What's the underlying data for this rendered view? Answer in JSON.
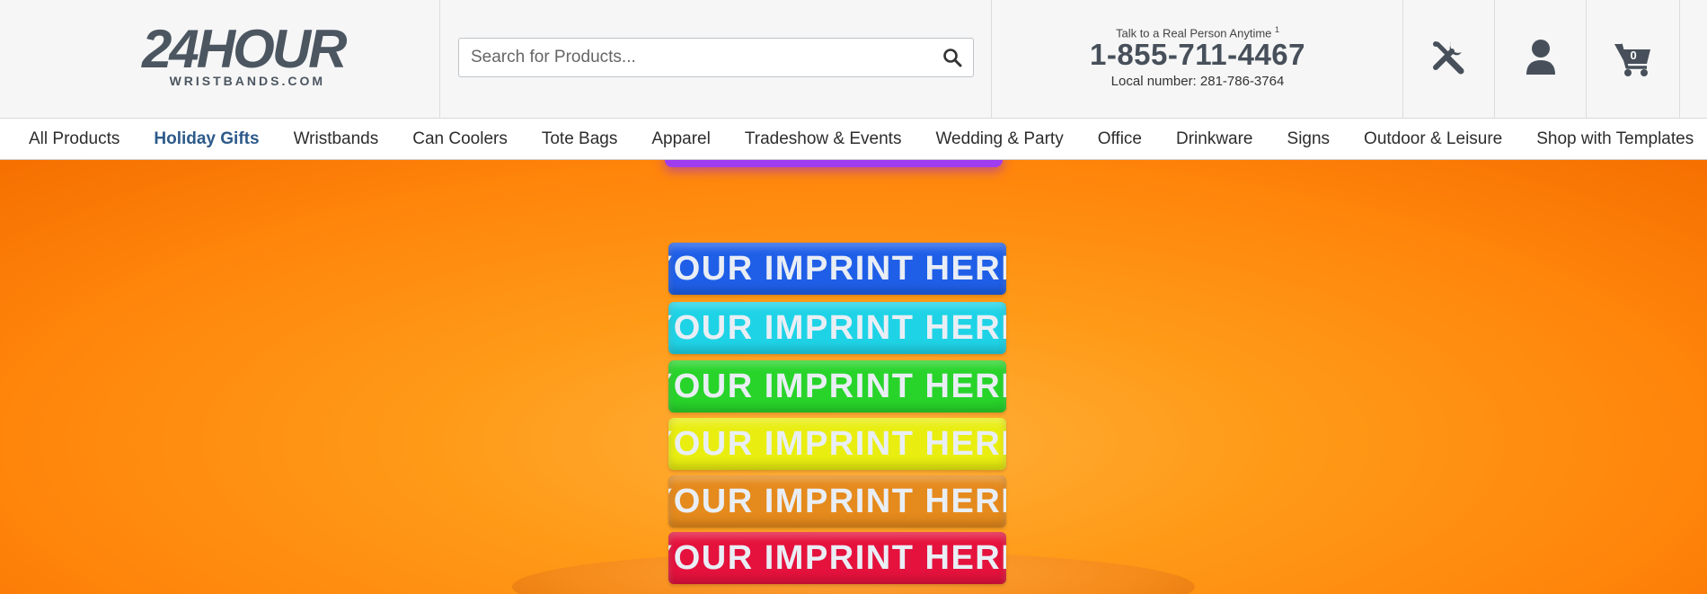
{
  "logo": {
    "main": "24HOUR",
    "sub": "WRISTBANDS.COM"
  },
  "search": {
    "placeholder": "Search for Products..."
  },
  "contact": {
    "tagline": "Talk to a Real Person Anytime",
    "tagline_sup": "1",
    "phone": "1-855-711-4467",
    "local": "Local number: 281-786-3764"
  },
  "icons": {
    "tools": "tools-icon",
    "account": "user-icon",
    "cart": "cart-icon"
  },
  "cart": {
    "count": "0"
  },
  "nav": {
    "items": [
      {
        "label": "All Products"
      },
      {
        "label": "Holiday Gifts",
        "active": true
      },
      {
        "label": "Wristbands"
      },
      {
        "label": "Can Coolers"
      },
      {
        "label": "Tote Bags"
      },
      {
        "label": "Apparel"
      },
      {
        "label": "Tradeshow & Events"
      },
      {
        "label": "Wedding & Party"
      },
      {
        "label": "Office"
      },
      {
        "label": "Drinkware"
      },
      {
        "label": "Signs"
      },
      {
        "label": "Outdoor & Leisure"
      },
      {
        "label": "Shop with Templates"
      }
    ]
  },
  "hero": {
    "bands": [
      {
        "text": "YOUR IMPRINT HERE",
        "color": "#1f5fe8"
      },
      {
        "text": "YOUR IMPRINT HERE",
        "color": "#1fd3e6"
      },
      {
        "text": "YOUR IMPRINT HERE",
        "color": "#28d42a"
      },
      {
        "text": "YOUR IMPRINT HERE",
        "color": "#e9ee10"
      },
      {
        "text": "YOUR IMPRINT HERE",
        "color": "#e58a1c"
      },
      {
        "text": "YOUR IMPRINT HERE",
        "color": "#e5123d"
      }
    ],
    "top_band_color": "#a03cf0"
  },
  "colors": {
    "brand": "#4c5661",
    "nav_active": "#2d5a8a",
    "hero_bg": "#ff9a17"
  }
}
